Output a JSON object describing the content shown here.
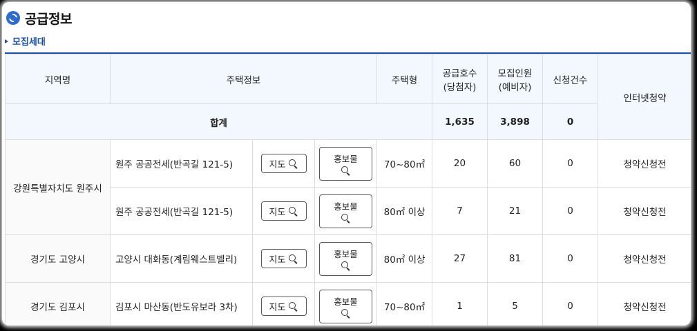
{
  "page": {
    "title": "공급정보",
    "section": "모집세대",
    "logo_icon": "refresh-circle-icon",
    "accent_color": "#1a4fa8"
  },
  "table": {
    "headers": {
      "region": "지역명",
      "housing_info": "주택정보",
      "housing_type": "주택형",
      "supply_units": "공급호수",
      "supply_units_sub": "(당첨자)",
      "recruit": "모집인원",
      "recruit_sub": "(예비자)",
      "applications": "신청건수",
      "internet": "인터넷청약"
    },
    "sum": {
      "label": "합계",
      "supply_units": "1,635",
      "recruit": "3,898",
      "applications": "0"
    },
    "map_button": "지도",
    "promo_button": "홍보물",
    "rows": [
      {
        "region": "강원특별자치도 원주시",
        "address": "원주 공공전세(반곡길 121-5)",
        "type": "70~80㎡",
        "supply": "20",
        "recruit": "60",
        "applications": "0",
        "status": "청약신청전"
      },
      {
        "region": "",
        "address": "원주 공공전세(반곡길 121-5)",
        "type": "80㎡ 이상",
        "supply": "7",
        "recruit": "21",
        "applications": "0",
        "status": "청약신청전"
      },
      {
        "region": "경기도 고양시",
        "address": "고양시 대화동(계림웨스트벨리)",
        "type": "80㎡ 이상",
        "supply": "27",
        "recruit": "81",
        "applications": "0",
        "status": "청약신청전"
      },
      {
        "region": "경기도 김포시",
        "address": "김포시 마산동(반도유보라 3차)",
        "type": "70~80㎡",
        "supply": "1",
        "recruit": "5",
        "applications": "0",
        "status": "청약신청전"
      }
    ]
  }
}
